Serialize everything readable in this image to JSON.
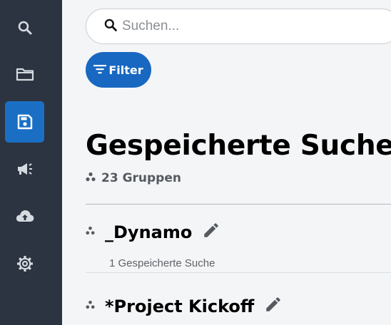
{
  "sidebar": {
    "items": [
      {
        "icon": "search-icon",
        "active": false
      },
      {
        "icon": "folder-icon",
        "active": false
      },
      {
        "icon": "save-icon",
        "active": true
      },
      {
        "icon": "megaphone-icon",
        "active": false
      },
      {
        "icon": "cloud-upload-icon",
        "active": false
      },
      {
        "icon": "gear-icon",
        "active": false
      }
    ],
    "background_color": "#2b3440",
    "active_color": "#1a6fc4"
  },
  "search": {
    "placeholder": "Suchen...",
    "value": ""
  },
  "filter": {
    "label": "Filter",
    "color": "#1868c2"
  },
  "page": {
    "title": "Gespeicherte Suche",
    "group_count": "23 Gruppen"
  },
  "groups": [
    {
      "name": "_Dynamo",
      "subtitle": "1 Gespeicherte Suche"
    },
    {
      "name": "*Project Kickoff",
      "subtitle": ""
    }
  ]
}
